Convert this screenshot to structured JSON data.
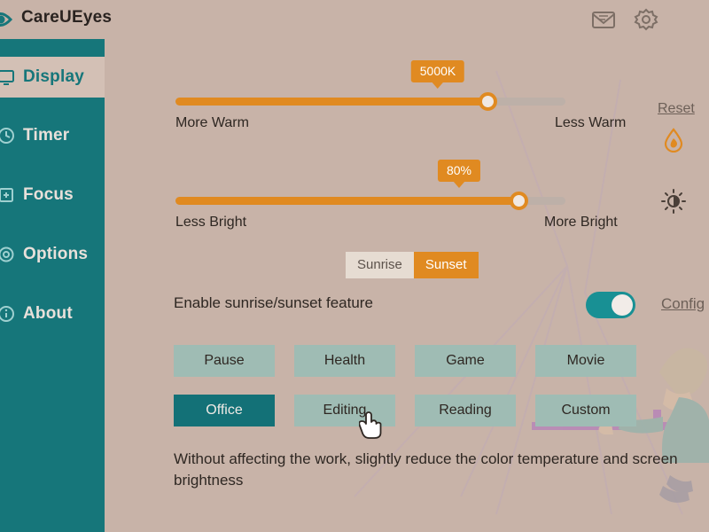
{
  "app": {
    "title": "CareUEyes",
    "logo_icon": "eye-logo-icon"
  },
  "titlebar": {
    "mail_icon": "mail-icon",
    "settings_icon": "gear-icon",
    "minimize_icon": "minimize-icon"
  },
  "sidebar": {
    "items": [
      {
        "label": "Display",
        "icon": "display-monitor-icon",
        "active": true
      },
      {
        "label": "Timer",
        "icon": "clock-icon",
        "active": false
      },
      {
        "label": "Focus",
        "icon": "focus-icon",
        "active": false
      },
      {
        "label": "Options",
        "icon": "options-gear-icon",
        "active": false
      },
      {
        "label": "About",
        "icon": "info-icon",
        "active": false
      }
    ]
  },
  "temperature": {
    "value_label": "5000K",
    "percent": 80,
    "left_label": "More Warm",
    "right_label": "Less Warm",
    "reset_label": "Reset",
    "icon": "droplet-icon"
  },
  "brightness": {
    "value_label": "80%",
    "percent": 88,
    "left_label": "Less Bright",
    "right_label": "More Bright",
    "icon": "brightness-icon"
  },
  "sunrise_sunset": {
    "segments": [
      {
        "label": "Sunrise",
        "active": false
      },
      {
        "label": "Sunset",
        "active": true
      }
    ],
    "enable_label": "Enable sunrise/sunset feature",
    "toggle_on": true,
    "config_label": "Config"
  },
  "presets": {
    "rows": [
      [
        {
          "label": "Pause",
          "active": false
        },
        {
          "label": "Health",
          "active": false
        },
        {
          "label": "Game",
          "active": false
        },
        {
          "label": "Movie",
          "active": false
        }
      ],
      [
        {
          "label": "Office",
          "active": true
        },
        {
          "label": "Editing",
          "active": false
        },
        {
          "label": "Reading",
          "active": false
        },
        {
          "label": "Custom",
          "active": false
        }
      ]
    ]
  },
  "description": "Without affecting the work, slightly reduce the color temperature and screen brightness",
  "colors": {
    "background": "#c8b3a8",
    "sidebar": "#16767a",
    "accent_orange": "#e08a21",
    "preset": "#9fbcb4",
    "preset_active": "#137177",
    "toggle_on": "#189094"
  }
}
